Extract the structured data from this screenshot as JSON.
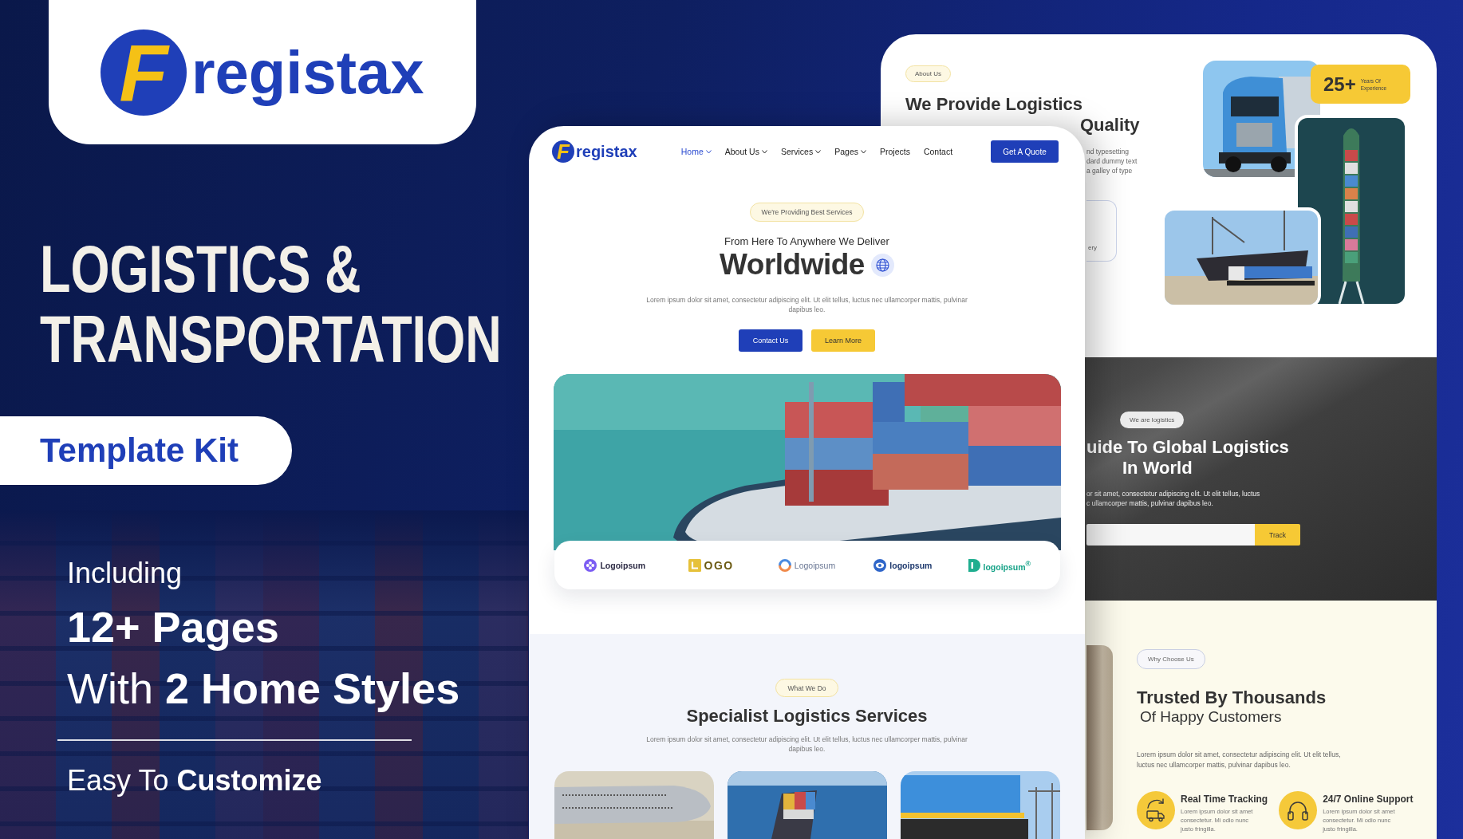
{
  "brand": {
    "initial": "F",
    "name": "registax"
  },
  "headline": "LOGISTICS & TRANSPORTATION",
  "ribbon": "Template Kit",
  "highlights": {
    "intro": "Including",
    "pages": "12+ Pages",
    "styles": "With **2 Home Styles**",
    "customize": "Easy To **Customize**"
  },
  "front_mockup": {
    "brand": {
      "initial": "F",
      "name": "registax"
    },
    "nav": [
      {
        "label": "Home",
        "dropdown": true,
        "selected": true
      },
      {
        "label": "About Us",
        "dropdown": true,
        "selected": false
      },
      {
        "label": "Services",
        "dropdown": true,
        "selected": false
      },
      {
        "label": "Pages",
        "dropdown": true,
        "selected": false
      },
      {
        "label": "Projects",
        "dropdown": false,
        "selected": false
      },
      {
        "label": "Contact",
        "dropdown": false,
        "selected": false
      }
    ],
    "cta": "Get A Quote",
    "hero": {
      "badge": "We're Providing Best Services",
      "tagline": "From Here To Anywhere We Deliver",
      "title": "Worldwide",
      "text": "Lorem ipsum dolor sit amet, consectetur adipiscing elit. Ut elit tellus, luctus nec ullamcorper mattis, pulvinar dapibus leo.",
      "buttons": [
        {
          "label": "Contact Us",
          "kind": "primary"
        },
        {
          "label": "Learn More",
          "kind": "secondary"
        }
      ]
    },
    "partners": [
      {
        "kind": "clover",
        "name": "Logoipsum"
      },
      {
        "kind": "square",
        "name": "OGO"
      },
      {
        "kind": "swirl",
        "name": "Logoipsum"
      },
      {
        "kind": "eye",
        "name": "logoipsum"
      },
      {
        "kind": "leaf",
        "name": "logoipsum$^{®}$"
      }
    ],
    "services": {
      "badge": "What We Do",
      "title": "Specialist Logistics Services",
      "text": "Lorem ipsum dolor sit amet, consectetur adipiscing elit. Ut elit tellus, luctus nec ullamcorper mattis, pulvinar dapibus leo."
    }
  },
  "back_mockup": {
    "about": {
      "badge": "About Us",
      "title": "We Provide Logistics",
      "title_cut": "Quality",
      "text_lines": [
        "nd typesetting",
        "dard dummy text",
        "a galley of type"
      ],
      "card_text": "ery",
      "stat": {
        "value": "25+",
        "label": "Years Of Experience"
      }
    },
    "tracking": {
      "badge": "We are logistics",
      "title_lines": [
        "uide To Global Logistics",
        "In World"
      ],
      "text_lines": [
        "or sit amet, consectetur adipiscing elit. Ut elit tellus, luctus",
        "c ullamcorper mattis, pulvinar dapibus leo."
      ],
      "button": "Track"
    },
    "why": {
      "badge": "Why Choose Us",
      "title_lines": [
        "Trusted By Thousands",
        "Of Happy Customers"
      ],
      "text": "Lorem ipsum dolor sit amet, consectetur adipiscing elit. Ut elit tellus, luctus nec ullamcorper mattis, pulvinar dapibus leo.",
      "features": [
        {
          "kind": "tracking",
          "title": "Real Time Tracking",
          "text": "Lorem ipsum dolor sit amet consectetur. Mi odio nunc justo fringilla."
        },
        {
          "kind": "support",
          "title": "24/7 Online Support",
          "text": "Lorem ipsum dolor sit amet consectetur. Mi odio nunc justo fringilla."
        }
      ]
    }
  }
}
